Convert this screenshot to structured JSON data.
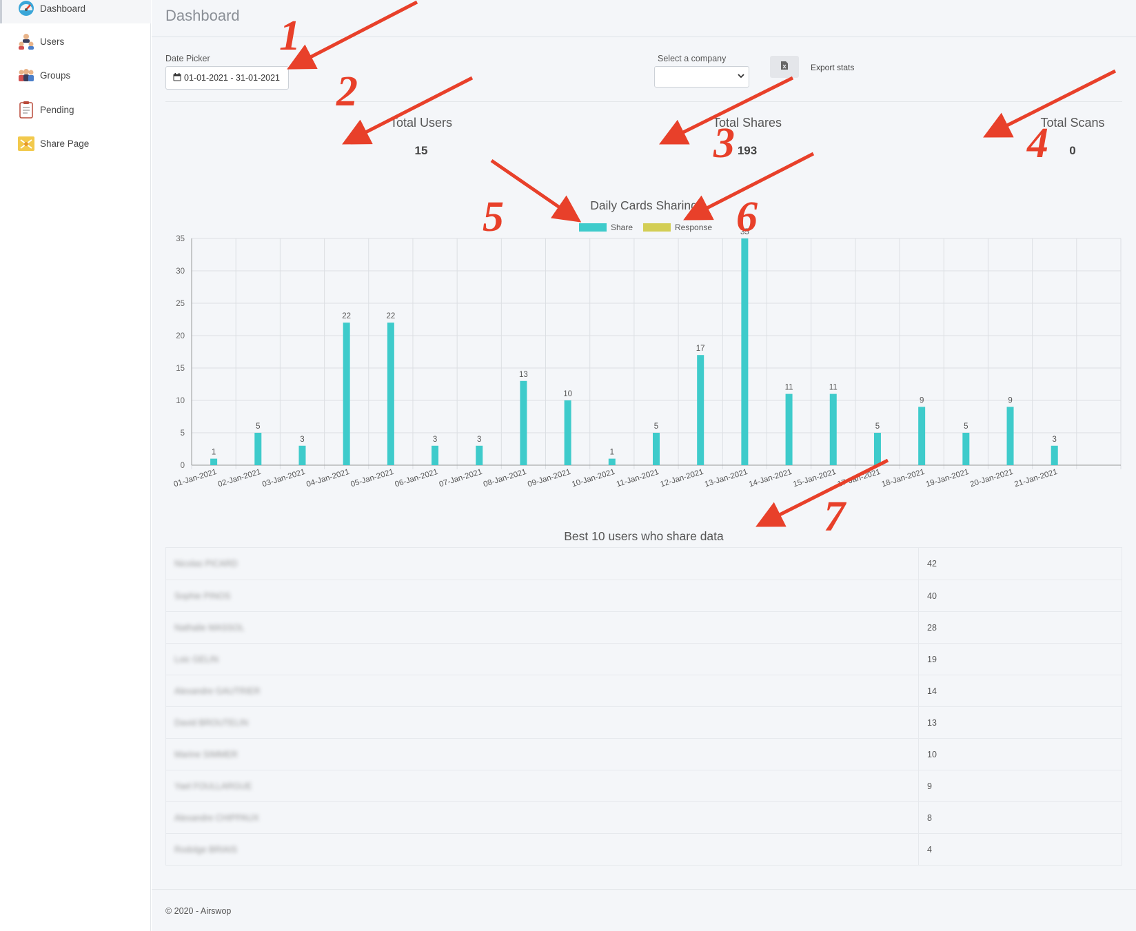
{
  "sidebar": {
    "items": [
      {
        "label": "Dashboard",
        "icon": "dashboard-gauge-icon"
      },
      {
        "label": "Users",
        "icon": "users-icon"
      },
      {
        "label": "Groups",
        "icon": "groups-icon"
      },
      {
        "label": "Pending",
        "icon": "clipboard-icon"
      },
      {
        "label": "Share Page",
        "icon": "share-page-icon"
      }
    ]
  },
  "header": {
    "title": "Dashboard"
  },
  "filters": {
    "date_label": "Date Picker",
    "date_value": "01-01-2021 - 31-01-2021",
    "company_label": "Select a company",
    "company_value": "",
    "export_label": "Export stats"
  },
  "stats": {
    "total_users_label": "Total Users",
    "total_users_value": "15",
    "total_shares_label": "Total Shares",
    "total_shares_value": "193",
    "total_scans_label": "Total Scans",
    "total_scans_value": "0"
  },
  "chart_data": {
    "type": "bar",
    "title": "Daily Cards Sharing",
    "categories": [
      "01-Jan-2021",
      "02-Jan-2021",
      "03-Jan-2021",
      "04-Jan-2021",
      "05-Jan-2021",
      "06-Jan-2021",
      "07-Jan-2021",
      "08-Jan-2021",
      "09-Jan-2021",
      "10-Jan-2021",
      "11-Jan-2021",
      "12-Jan-2021",
      "13-Jan-2021",
      "14-Jan-2021",
      "15-Jan-2021",
      "17-Jan-2021",
      "18-Jan-2021",
      "19-Jan-2021",
      "20-Jan-2021",
      "21-Jan-2021"
    ],
    "series": [
      {
        "name": "Share",
        "color": "#3ecbcb",
        "values": [
          1,
          5,
          3,
          22,
          22,
          3,
          3,
          13,
          10,
          1,
          5,
          17,
          35,
          11,
          11,
          5,
          9,
          5,
          9,
          3
        ]
      },
      {
        "name": "Response",
        "color": "#d3ce55",
        "values": [
          0,
          0,
          0,
          0,
          0,
          0,
          0,
          0,
          0,
          0,
          0,
          0,
          0,
          0,
          0,
          0,
          0,
          0,
          0,
          0
        ]
      }
    ],
    "ylim": [
      0,
      35
    ],
    "yticks": [
      0,
      5,
      10,
      15,
      20,
      25,
      30,
      35
    ],
    "grid": true,
    "legend": "top-center"
  },
  "top_users": {
    "title": "Best 10 users who share data",
    "rows": [
      {
        "name": "Nicolas PICARD",
        "value": "42"
      },
      {
        "name": "Sophie PINOS",
        "value": "40"
      },
      {
        "name": "Nathalie MASSOL",
        "value": "28"
      },
      {
        "name": "Loic GELIN",
        "value": "19"
      },
      {
        "name": "Alexandre GAUTRIER",
        "value": "14"
      },
      {
        "name": "David BROUTELIN",
        "value": "13"
      },
      {
        "name": "Marine SIMMER",
        "value": "10"
      },
      {
        "name": "Yael FOULLARGUE",
        "value": "9"
      },
      {
        "name": "Alexandre CHIPPAUX",
        "value": "8"
      },
      {
        "name": "Rodolge BRIAIS",
        "value": "4"
      }
    ]
  },
  "footer": {
    "text": "© 2020 - Airswop"
  },
  "annotations": [
    "1",
    "2",
    "3",
    "4",
    "5",
    "6",
    "7"
  ]
}
